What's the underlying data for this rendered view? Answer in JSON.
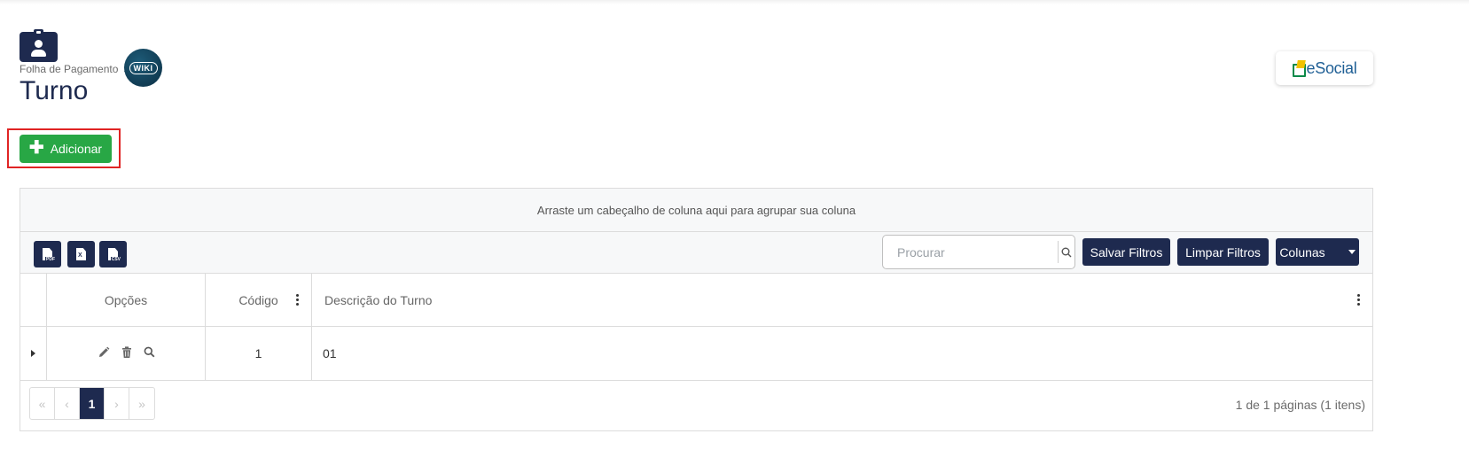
{
  "header": {
    "breadcrumb": "Folha de Pagamento",
    "breadcrumb_separator": ">",
    "wiki_label": "WIKI",
    "title": "Turno",
    "esocial_label": "eSocial"
  },
  "actions": {
    "add_label": "Adicionar",
    "add_icon": "plus-icon"
  },
  "grid": {
    "group_panel_text": "Arraste um cabeçalho de coluna aqui para agrupar sua coluna",
    "export_buttons": [
      {
        "label": "PDF",
        "icon": "pdf-export-icon"
      },
      {
        "label": "X",
        "icon": "excel-export-icon"
      },
      {
        "label": "CSV",
        "icon": "csv-export-icon"
      }
    ],
    "search_placeholder": "Procurar",
    "save_filters_label": "Salvar Filtros",
    "clear_filters_label": "Limpar Filtros",
    "columns_label": "Colunas",
    "columns": {
      "options": "Opções",
      "code": "Código",
      "description": "Descrição do Turno"
    },
    "rows": [
      {
        "code": "1",
        "description": "01"
      }
    ],
    "pagination": {
      "first": "«",
      "prev": "‹",
      "current": "1",
      "next": "›",
      "last": "»",
      "info": "1 de 1 páginas (1 itens)"
    }
  },
  "colors": {
    "primary": "#1e2a4f",
    "success": "#28a745",
    "highlight": "#e02424"
  }
}
